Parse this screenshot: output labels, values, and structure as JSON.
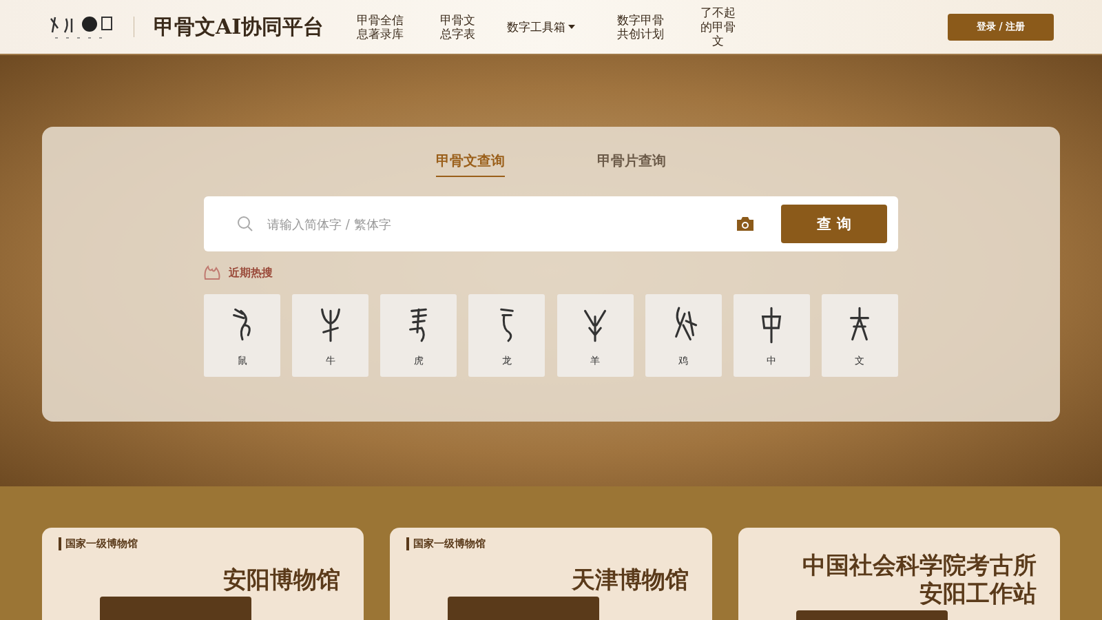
{
  "header": {
    "title": "甲骨文AI协同平台",
    "nav": [
      {
        "label": "甲骨全信息著录库",
        "dropdown": false
      },
      {
        "label": "甲骨文总字表",
        "dropdown": false
      },
      {
        "label": "数字工具箱",
        "dropdown": true
      },
      {
        "label": "数字甲骨共创计划",
        "dropdown": false
      },
      {
        "label": "了不起的甲骨文",
        "dropdown": false
      }
    ],
    "login": "登录 / 注册"
  },
  "search": {
    "tabs": [
      {
        "label": "甲骨文查询",
        "selected": true
      },
      {
        "label": "甲骨片查询",
        "selected": false
      }
    ],
    "placeholder": "请输入简体字 / 繁体字",
    "button": "查 询",
    "hot_label": "近期热搜",
    "hot": [
      {
        "label": "鼠"
      },
      {
        "label": "牛"
      },
      {
        "label": "虎"
      },
      {
        "label": "龙"
      },
      {
        "label": "羊"
      },
      {
        "label": "鸡"
      },
      {
        "label": "中"
      },
      {
        "label": "文"
      }
    ]
  },
  "museums": [
    {
      "tag": "国家一级博物馆",
      "title": [
        "安阳博物馆"
      ]
    },
    {
      "tag": "国家一级博物馆",
      "title": [
        "天津博物馆"
      ]
    },
    {
      "title": [
        "中国社会科学院考古所",
        "安阳工作站"
      ]
    }
  ]
}
